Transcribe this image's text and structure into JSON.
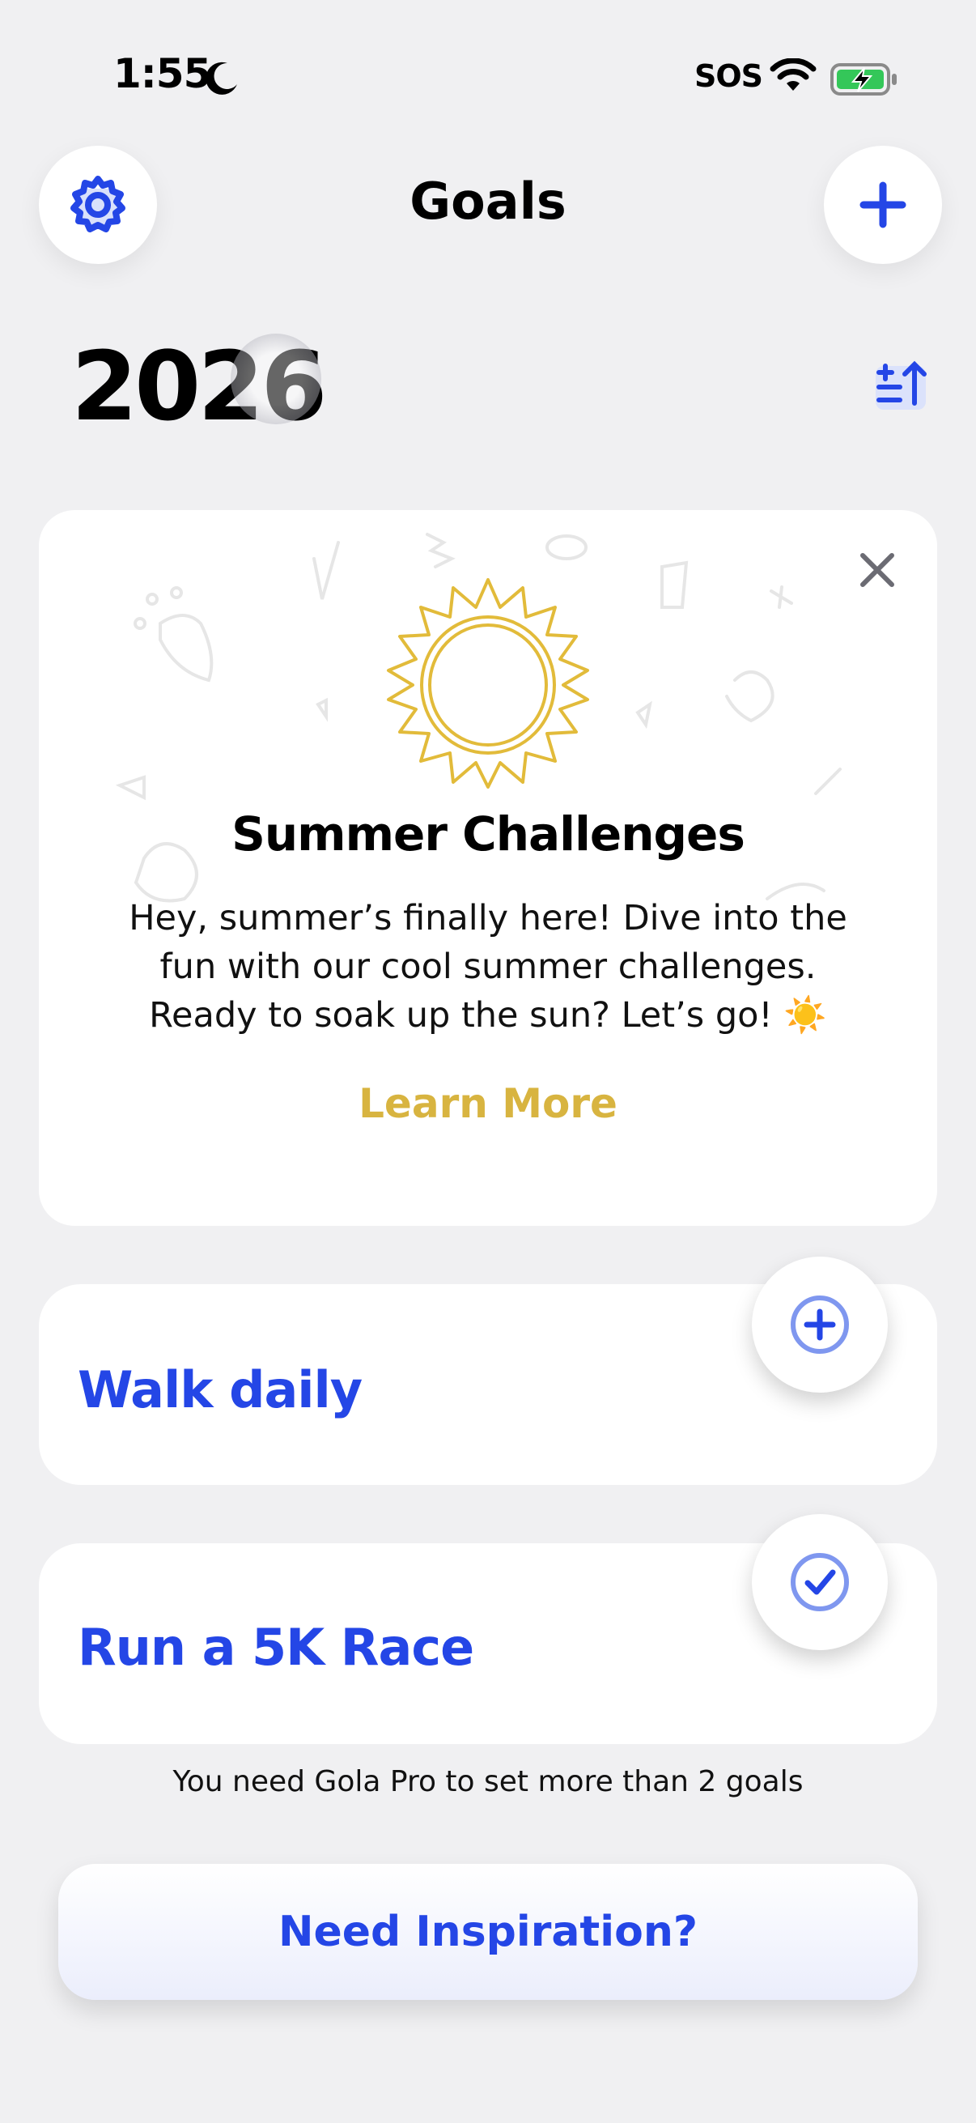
{
  "status_bar": {
    "time": "1:55",
    "carrier": "SOS",
    "icons": [
      "moon-icon",
      "wifi-icon",
      "battery-charging-icon"
    ]
  },
  "header": {
    "title": "Goals",
    "settings_icon": "gear-icon",
    "add_icon": "plus-icon"
  },
  "year": "2026",
  "sort_icon": "sort-ascending-icon",
  "promo": {
    "title": "Summer Challenges",
    "body": "Hey, summer’s finally here! Dive into the fun with our cool summer challenges. Ready to soak up the sun? Let’s go! ☀️",
    "link": "Learn More",
    "close_icon": "close-icon",
    "illustration": "sun-icon"
  },
  "goals": [
    {
      "title": "Walk daily",
      "action_icon": "plus-circle-icon"
    },
    {
      "title": "Run a 5K Race",
      "action_icon": "check-circle-icon"
    }
  ],
  "pro_note": "You need Gola Pro to set more than 2 goals",
  "inspiration_button": "Need Inspiration?",
  "colors": {
    "accent_blue": "#2446e6",
    "promo_gold": "#d8b440",
    "background": "#f0f0f2"
  }
}
